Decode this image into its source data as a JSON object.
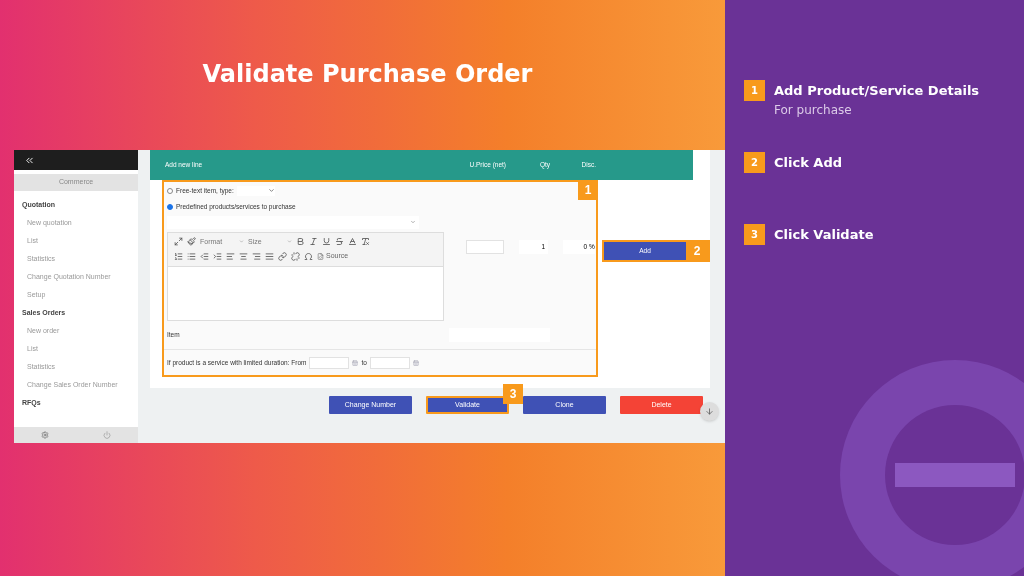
{
  "title": "Validate Purchase Order",
  "sidebar": {
    "section": "Commerce",
    "items": [
      {
        "label": "Quotation",
        "kind": "heading"
      },
      {
        "label": "New quotation",
        "kind": "link"
      },
      {
        "label": "List",
        "kind": "link"
      },
      {
        "label": "Statistics",
        "kind": "link"
      },
      {
        "label": "Change Quotation Number",
        "kind": "link"
      },
      {
        "label": "Setup",
        "kind": "link"
      },
      {
        "label": "Sales Orders",
        "kind": "heading"
      },
      {
        "label": "New order",
        "kind": "link"
      },
      {
        "label": "List",
        "kind": "link"
      },
      {
        "label": "Statistics",
        "kind": "link"
      },
      {
        "label": "Change Sales Order Number",
        "kind": "link"
      },
      {
        "label": "RFQs",
        "kind": "heading"
      }
    ]
  },
  "table": {
    "columns": [
      "Add new line",
      "U.Price (net)",
      "Qty",
      "Disc."
    ]
  },
  "form": {
    "radios": [
      {
        "label": "Free-text item, type:",
        "selected": false
      },
      {
        "label": "Predefined products/services to purchase",
        "selected": true
      }
    ],
    "format": "Format",
    "size": "Size",
    "source": "Source",
    "qty": "1",
    "disc": "0",
    "percent": "%",
    "item_label": "Item",
    "duration_label": "If product is a service with limited duration: From",
    "to_label": "to",
    "add_button": "Add"
  },
  "buttons": [
    {
      "label": "Change Number",
      "kind": "primary",
      "highlighted": false
    },
    {
      "label": "Validate",
      "kind": "primary",
      "highlighted": true
    },
    {
      "label": "Clone",
      "kind": "primary",
      "highlighted": false
    },
    {
      "label": "Delete",
      "kind": "danger",
      "highlighted": false
    }
  ],
  "markers": [
    "1",
    "2",
    "3"
  ],
  "steps": [
    {
      "number": "1",
      "title": "Add Product/Service Details",
      "subtitle": "For purchase"
    },
    {
      "number": "2",
      "title": "Click Add"
    },
    {
      "number": "3",
      "title": "Click Validate"
    }
  ]
}
